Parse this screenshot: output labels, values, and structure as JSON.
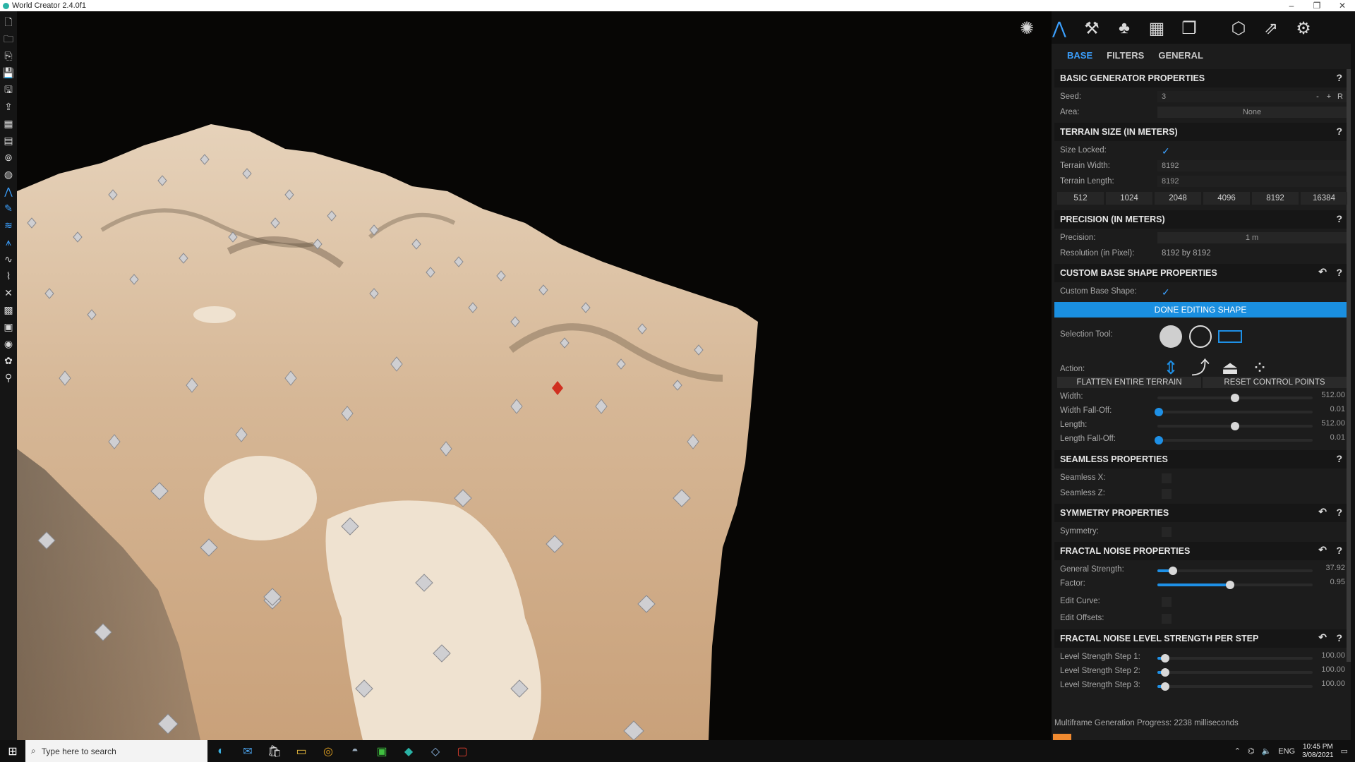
{
  "app": {
    "title": "World Creator 2.4.0f1"
  },
  "window_controls": {
    "minimize": "–",
    "maximize": "❐",
    "close": "✕"
  },
  "left_toolbar": [
    "new-file",
    "open",
    "import",
    "save",
    "save-as",
    "export",
    "map",
    "terrain-layers",
    "binoculars",
    "globe",
    "mountain",
    "brush",
    "water",
    "grass",
    "path",
    "transform",
    "grid",
    "image",
    "sphere",
    "settings",
    "stamp"
  ],
  "top_tools": [
    "generator",
    "mountain",
    "sculpt",
    "forest",
    "map",
    "layers",
    "export-3d",
    "share",
    "settings"
  ],
  "panel": {
    "tabs": [
      "BASE",
      "FILTERS",
      "GENERAL"
    ],
    "active_tab": "BASE",
    "basic": {
      "title": "BASIC GENERATOR PROPERTIES",
      "help": "?",
      "seed_label": "Seed:",
      "seed_value": "3",
      "seed_minus": "-",
      "seed_plus": "+",
      "seed_random": "R",
      "area_label": "Area:",
      "area_value": "None"
    },
    "terrain_size": {
      "title": "TERRAIN SIZE (IN METERS)",
      "help": "?",
      "size_locked_label": "Size Locked:",
      "size_locked": true,
      "width_label": "Terrain Width:",
      "width_value": "8192",
      "length_label": "Terrain Length:",
      "length_value": "8192",
      "presets": [
        "512",
        "1024",
        "2048",
        "4096",
        "8192",
        "16384"
      ]
    },
    "precision": {
      "title": "PRECISION (IN METERS)",
      "help": "?",
      "precision_label": "Precision:",
      "precision_value": "1 m",
      "resolution_label": "Resolution (in Pixel):",
      "resolution_value": "8192 by 8192"
    },
    "custom_shape": {
      "title": "CUSTOM BASE SHAPE PROPERTIES",
      "help": "?",
      "custom_label": "Custom Base Shape:",
      "custom_checked": true,
      "done_button": "DONE EDITING SHAPE",
      "selection_label": "Selection Tool:",
      "action_label": "Action:",
      "flatten_button": "FLATTEN ENTIRE TERRAIN",
      "reset_button": "RESET CONTROL POINTS",
      "width_label": "Width:",
      "width_value": "512.00",
      "width_level": 0.5,
      "width_falloff_label": "Width Fall-Off:",
      "width_falloff_value": "0.01",
      "width_falloff_level": 0.01,
      "length_label": "Length:",
      "length_value": "512.00",
      "length_level": 0.5,
      "length_falloff_label": "Length Fall-Off:",
      "length_falloff_value": "0.01",
      "length_falloff_level": 0.01
    },
    "seamless": {
      "title": "SEAMLESS PROPERTIES",
      "help": "?",
      "x_label": "Seamless X:",
      "z_label": "Seamless Z:"
    },
    "symmetry": {
      "title": "SYMMETRY PROPERTIES",
      "help": "?",
      "symmetry_label": "Symmetry:"
    },
    "fractal": {
      "title": "FRACTAL NOISE PROPERTIES",
      "help": "?",
      "strength_label": "General Strength:",
      "strength_value": "37.92",
      "strength_level": 0.1,
      "factor_label": "Factor:",
      "factor_value": "0.95",
      "factor_level": 0.47,
      "curve_label": "Edit Curve:",
      "offsets_label": "Edit Offsets:"
    },
    "fractal_steps": {
      "title": "FRACTAL NOISE LEVEL STRENGTH PER STEP",
      "help": "?",
      "steps": [
        {
          "label": "Level Strength Step 1:",
          "value": "100.00",
          "level": 0.05
        },
        {
          "label": "Level Strength Step 2:",
          "value": "100.00",
          "level": 0.05
        },
        {
          "label": "Level Strength Step 3:",
          "value": "100.00",
          "level": 0.05
        }
      ]
    }
  },
  "status": {
    "progress_text": "Multiframe Generation Progress: 2238 milliseconds"
  },
  "taskbar": {
    "search_placeholder": "Type here to search",
    "apps": [
      "edge",
      "mail",
      "store",
      "explorer",
      "chrome",
      "steam",
      "app-green",
      "world-creator",
      "app-blue",
      "app-red"
    ],
    "tray_lang": "ENG",
    "time": "10:45 PM",
    "date": "3/08/2021"
  },
  "colors": {
    "accent": "#1a8fe0",
    "progress": "#f08a30",
    "marker_selected": "#d03020",
    "terrain": "#d2b493"
  }
}
